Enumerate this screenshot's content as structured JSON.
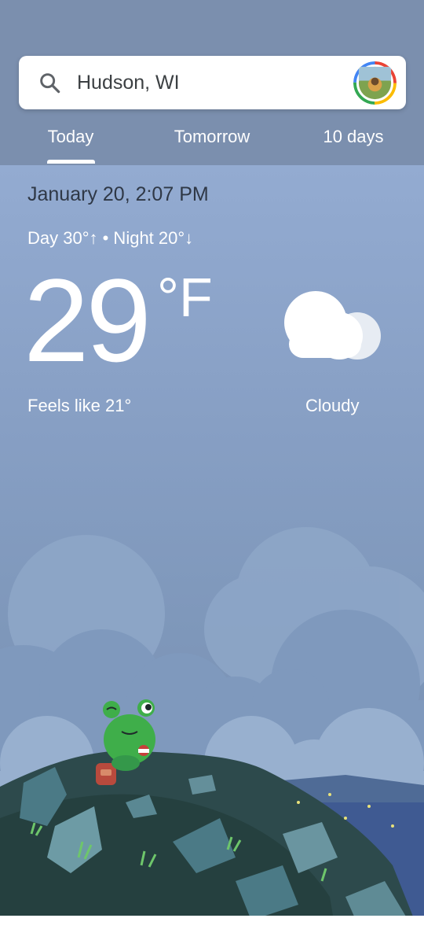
{
  "search": {
    "location": "Hudson, WI",
    "icon": "search-icon"
  },
  "tabs": [
    {
      "label": "Today",
      "selected": true
    },
    {
      "label": "Tomorrow",
      "selected": false
    },
    {
      "label": "10 days",
      "selected": false
    }
  ],
  "weather": {
    "datetime": "January 20, 2:07 PM",
    "day_night": "Day 30°↑ • Night 20°↓",
    "temperature": "29",
    "unit": "°F",
    "feels_like": "Feels like 21°",
    "condition": "Cloudy",
    "condition_icon": "cloud-icon"
  },
  "colors": {
    "header": "#7b8fae",
    "sky_top": "#9cb3d9",
    "text_dark": "#2f3846",
    "frog": "#3fae4a"
  }
}
